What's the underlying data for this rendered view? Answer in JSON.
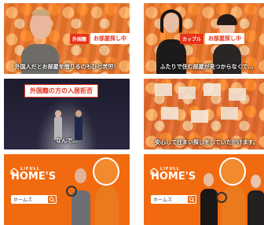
{
  "panels": [
    {
      "tag": "外国籍",
      "label": "お部屋探し中",
      "subtitle": "外国人だとお部屋を借りるのもひと苦労！"
    },
    {
      "tag": "カップル",
      "label": "お部屋探し中",
      "subtitle": "ふたりで住む部屋が見つからなくて…"
    },
    {
      "title": "外国籍の方の入居拒否",
      "subtitle": "なんで…"
    },
    {
      "subtitle": "安心して住まい探しをしていただけます。"
    },
    {
      "logo_small": "LIFULL",
      "logo_big": "HOME'S",
      "search_text": "ホームズ"
    },
    {
      "logo_small": "LIFULL",
      "logo_big": "HOME'S",
      "search_text": "ホームズ"
    }
  ],
  "colors": {
    "brand_orange": "#f26a10",
    "tag_red": "#e8321a"
  }
}
